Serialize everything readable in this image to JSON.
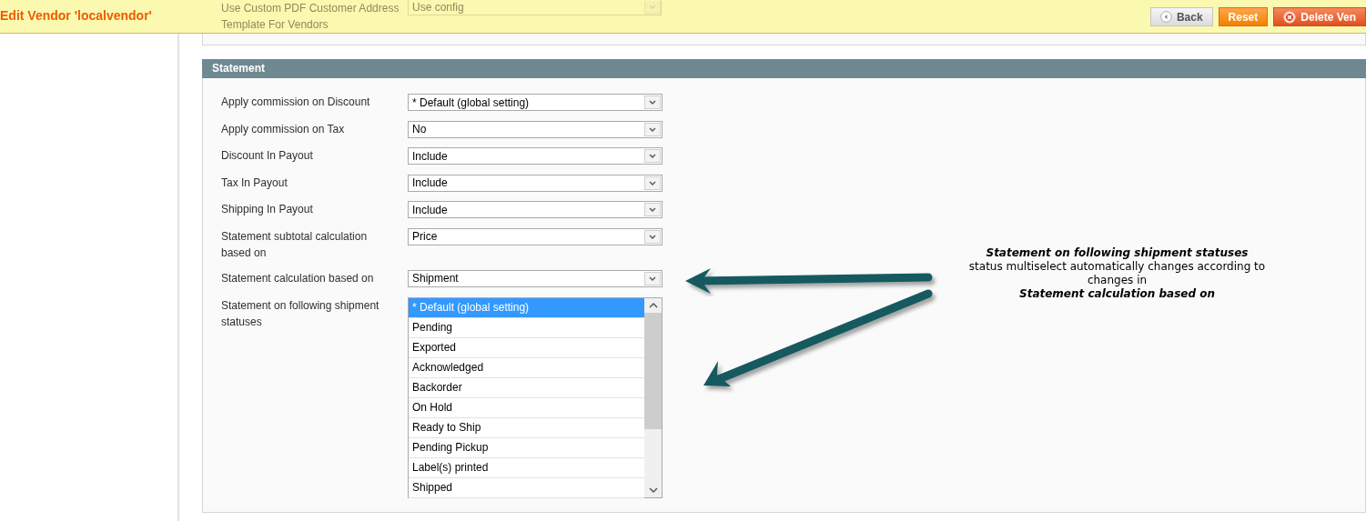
{
  "header": {
    "title": "Edit Vendor 'localvendor'",
    "faded_field": {
      "label": "Use Custom PDF Customer Address Template For Vendors",
      "value": "Use config"
    },
    "buttons": [
      {
        "kind": "back",
        "label": "Back"
      },
      {
        "kind": "reset",
        "label": "Reset"
      },
      {
        "kind": "delete",
        "label": "Delete Ven"
      }
    ]
  },
  "section": {
    "title": "Statement",
    "fields": [
      {
        "label": "Apply commission on Discount",
        "value": "* Default (global setting)"
      },
      {
        "label": "Apply commission on Tax",
        "value": "No"
      },
      {
        "label": "Discount In Payout",
        "value": "Include"
      },
      {
        "label": "Tax In Payout",
        "value": "Include"
      },
      {
        "label": "Shipping In Payout",
        "value": "Include"
      },
      {
        "label": "Statement subtotal calculation based on",
        "value": "Price"
      },
      {
        "label": "Statement calculation based on",
        "value": "Shipment"
      }
    ],
    "multiselect": {
      "label": "Statement on following shipment statuses",
      "options": [
        {
          "label": "* Default (global setting)",
          "selected": true
        },
        {
          "label": "Pending",
          "selected": false
        },
        {
          "label": "Exported",
          "selected": false
        },
        {
          "label": "Acknowledged",
          "selected": false
        },
        {
          "label": "Backorder",
          "selected": false
        },
        {
          "label": "On Hold",
          "selected": false
        },
        {
          "label": "Ready to Ship",
          "selected": false
        },
        {
          "label": "Pending Pickup",
          "selected": false
        },
        {
          "label": "Label(s) printed",
          "selected": false
        },
        {
          "label": "Shipped",
          "selected": false
        }
      ]
    }
  },
  "annotation": {
    "heading": "Statement on following shipment statuses",
    "body": "status multiselect automatically changes according to changes in",
    "footer": "Statement calculation based on"
  }
}
